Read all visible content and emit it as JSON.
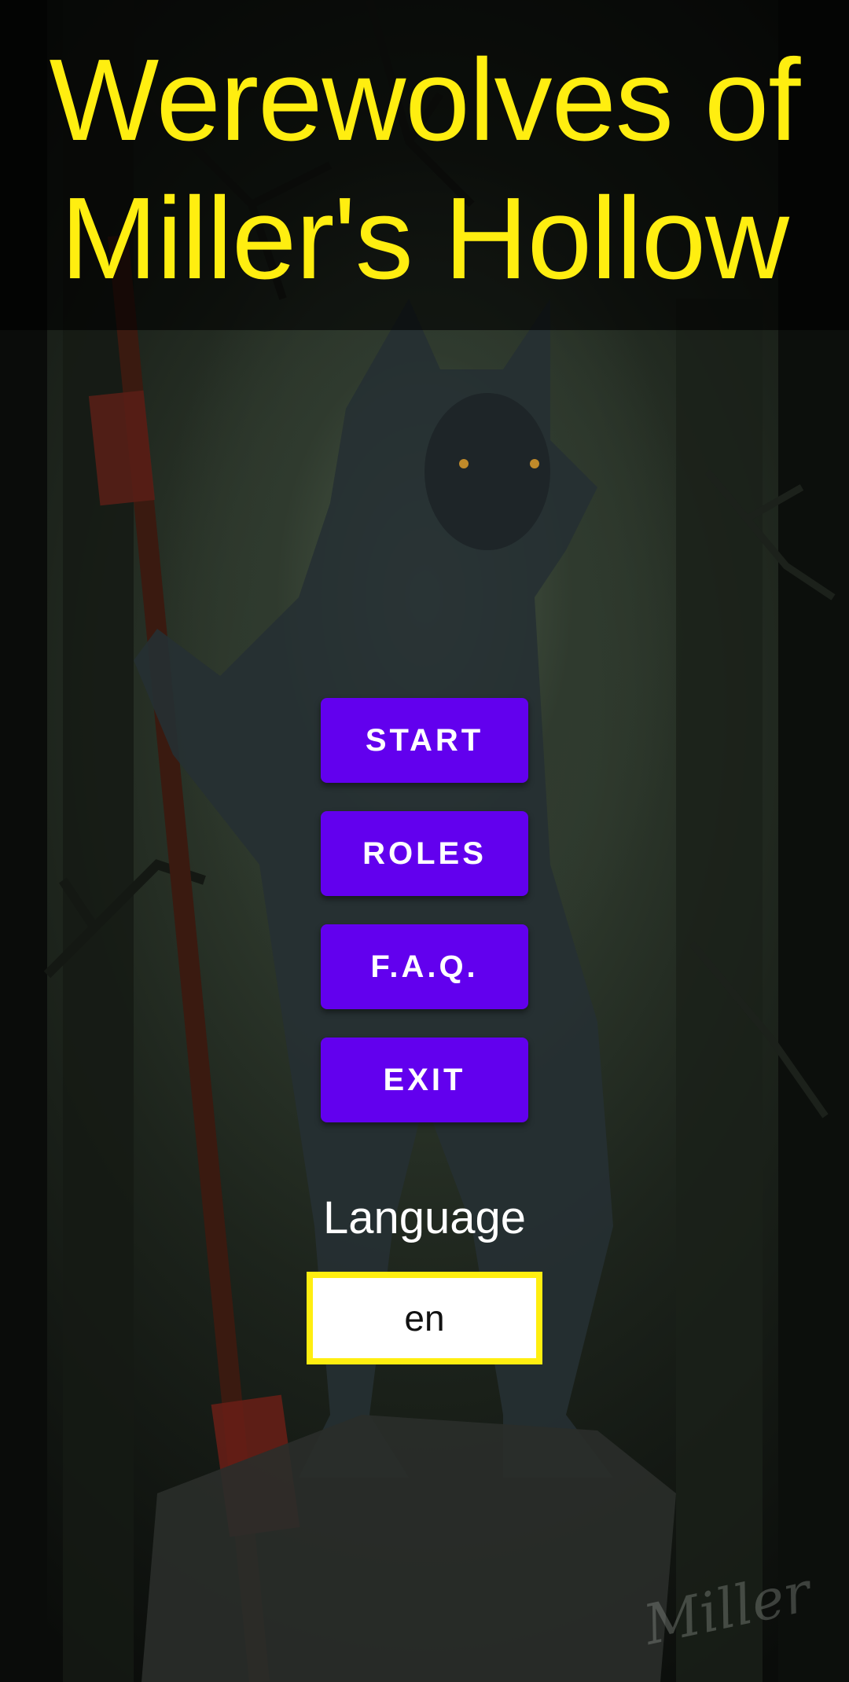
{
  "title": {
    "line1": "Werewolves of",
    "line2": "Miller's Hollow"
  },
  "menu": {
    "start_label": "START",
    "roles_label": "ROLES",
    "faq_label": "F.A.Q.",
    "exit_label": "EXIT"
  },
  "language": {
    "label": "Language",
    "selected": "en"
  },
  "colors": {
    "title": "#ffee10",
    "button": "#6200ee",
    "select_border": "#ffee10"
  },
  "background": {
    "signature": "Miller"
  }
}
